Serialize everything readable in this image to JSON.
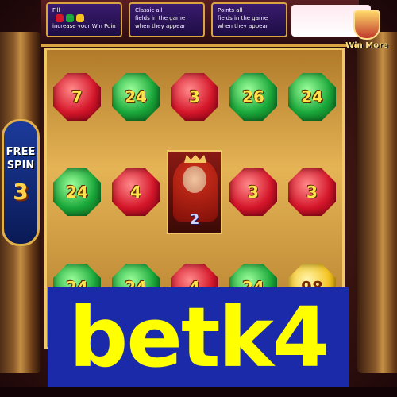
{
  "top_panels": [
    {
      "lines": [
        "Fill",
        "increase your Win Points"
      ]
    },
    {
      "lines": [
        "Classic all",
        "fields in the game",
        "when they appear"
      ]
    },
    {
      "lines": [
        "Points all",
        "fields in the game",
        "when they appear"
      ]
    }
  ],
  "win_more": {
    "label": "Win More"
  },
  "free_spin": {
    "line1": "FREE",
    "line2": "SPIN",
    "count": "3"
  },
  "grid": {
    "rows": [
      [
        {
          "color": "red",
          "value": "7"
        },
        {
          "color": "green",
          "value": "24"
        },
        {
          "color": "red",
          "value": "3"
        },
        {
          "color": "green",
          "value": "26"
        },
        {
          "color": "green",
          "value": "24"
        }
      ],
      [
        {
          "color": "green",
          "value": "24"
        },
        {
          "color": "red",
          "value": "4"
        },
        {
          "color": "queen",
          "value": "2"
        },
        {
          "color": "red",
          "value": "3"
        },
        {
          "color": "red",
          "value": "3"
        }
      ],
      [
        {
          "color": "green",
          "value": "24"
        },
        {
          "color": "green",
          "value": "24"
        },
        {
          "color": "red",
          "value": "4"
        },
        {
          "color": "green",
          "value": "24"
        },
        {
          "color": "yellow",
          "value": "98"
        }
      ]
    ]
  },
  "brand": {
    "text": "betk4"
  },
  "colors": {
    "frame_gold": "#f2c866",
    "brand_bg": "#1a2aa8",
    "brand_text": "#ffff00"
  }
}
